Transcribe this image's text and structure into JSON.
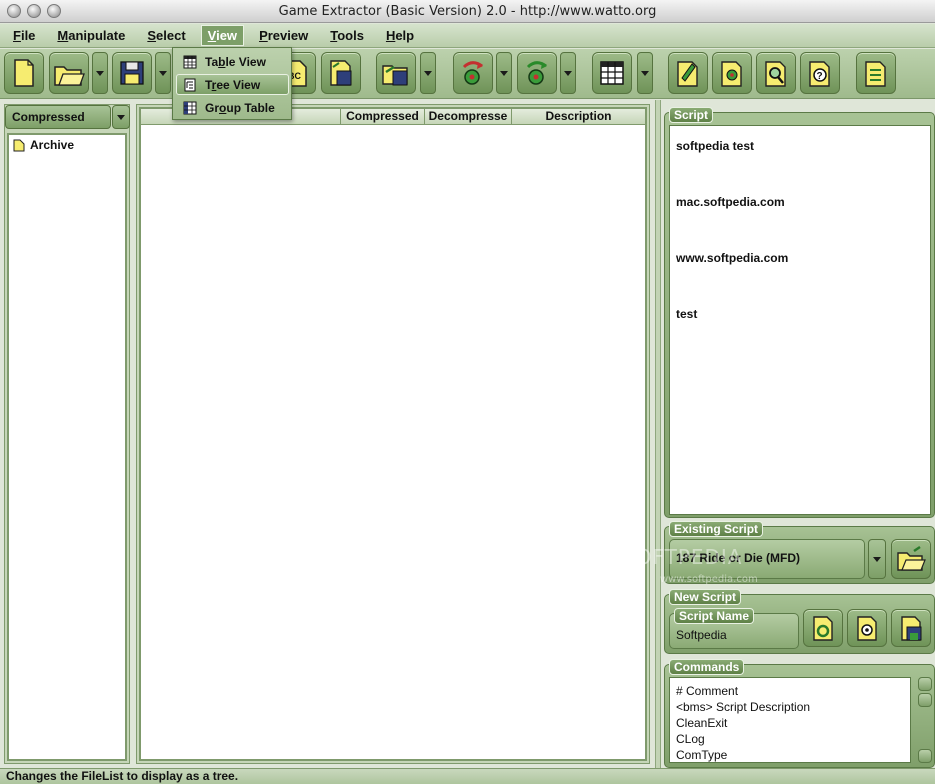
{
  "window": {
    "title": "Game Extractor (Basic Version) 2.0 - http://www.watto.org"
  },
  "menubar": {
    "items": [
      {
        "label_pre": "",
        "label_u": "F",
        "label_post": "ile"
      },
      {
        "label_pre": "",
        "label_u": "M",
        "label_post": "anipulate"
      },
      {
        "label_pre": "",
        "label_u": "S",
        "label_post": "elect"
      },
      {
        "label_pre": "",
        "label_u": "V",
        "label_post": "iew"
      },
      {
        "label_pre": "",
        "label_u": "P",
        "label_post": "review"
      },
      {
        "label_pre": "",
        "label_u": "T",
        "label_post": "ools"
      },
      {
        "label_pre": "",
        "label_u": "H",
        "label_post": "elp"
      }
    ],
    "active_index": 3
  },
  "view_menu": {
    "items": [
      {
        "pre": "Ta",
        "u": "b",
        "post": "le View",
        "icon": "table-icon"
      },
      {
        "pre": "T",
        "u": "r",
        "post": "ee View",
        "icon": "tree-icon"
      },
      {
        "pre": "Gr",
        "u": "o",
        "post": "up Table",
        "icon": "group-table-icon"
      }
    ],
    "highlighted_index": 1
  },
  "left_panel": {
    "combo_value": "Compressed",
    "tree_root": "Archive"
  },
  "file_table": {
    "columns": [
      "",
      "Compressed",
      "Decompresse",
      "Description"
    ]
  },
  "script_panel": {
    "label": "Script",
    "lines": [
      "softpedia test",
      "mac.softpedia.com",
      "www.softpedia.com",
      "test"
    ]
  },
  "existing_script": {
    "label": "Existing Script",
    "value": "187 Ride or Die (MFD)"
  },
  "new_script": {
    "label": "New Script",
    "name_label": "Script Name",
    "name_value": "Softpedia"
  },
  "commands": {
    "label": "Commands",
    "items": [
      "# Comment",
      "<bms> Script Description",
      "CleanExit",
      "CLog",
      "ComType"
    ]
  },
  "watermark": {
    "main": "SOFTPEDIA",
    "sub": "www.softpedia.com"
  },
  "status": {
    "text": "Changes the FileList to display as a tree."
  },
  "colors": {
    "accent": "#7d9f68",
    "panel": "#c6d6b8",
    "dark_green": "#56733f"
  }
}
